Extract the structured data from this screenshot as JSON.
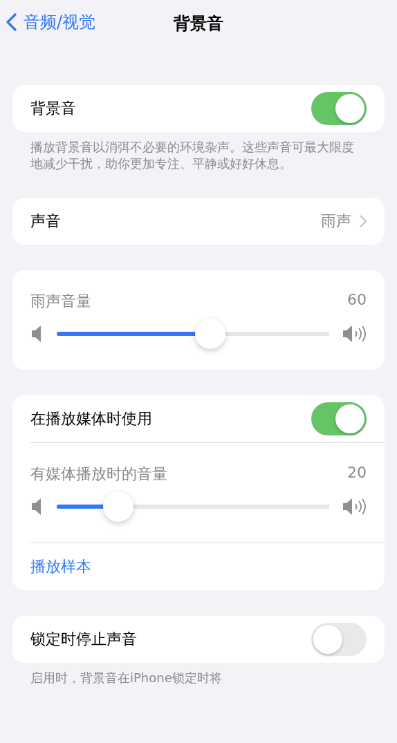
{
  "nav": {
    "back_label": "音频/视觉",
    "title": "背景音"
  },
  "sections": [
    {
      "rows": [
        {
          "kind": "toggle",
          "label": "背景音",
          "on": true
        }
      ],
      "footer": "播放背景音以消弭不必要的环境杂声。这些声音可最大限度地减少干扰，助你更加专注、平静或好好休息。"
    },
    {
      "rows": [
        {
          "kind": "value",
          "label": "声音",
          "value": "雨声"
        }
      ]
    },
    {
      "rows": [
        {
          "kind": "slider",
          "label": "雨声音量",
          "reading": "60",
          "level": 0.6
        }
      ]
    },
    {
      "rows": [
        {
          "kind": "toggle",
          "label": "在播放媒体时使用",
          "on": true
        },
        {
          "kind": "slider",
          "label": "有媒体播放时的音量",
          "reading": "20",
          "level": 0.2
        },
        {
          "kind": "link",
          "label": "播放样本"
        }
      ]
    },
    {
      "rows": [
        {
          "kind": "toggle",
          "label": "锁定时停止声音",
          "on": false
        }
      ],
      "footer": "启用时，背景音在iPhone锁定时将"
    }
  ]
}
